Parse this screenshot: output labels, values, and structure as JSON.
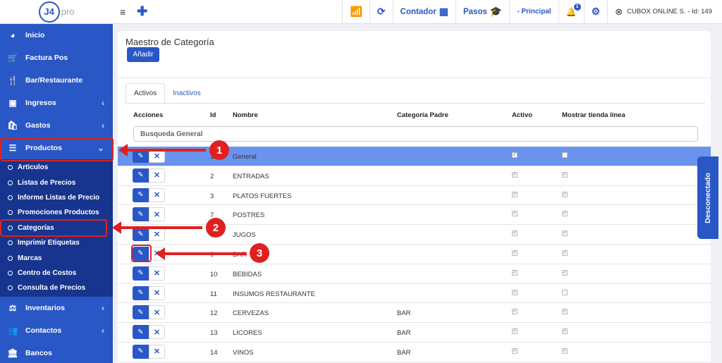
{
  "logo": {
    "mark": "J4",
    "suffix": "pro"
  },
  "topbar": {
    "contador": "Contador",
    "pasos": "Pasos",
    "principal": "- Principal",
    "notif_count": "1",
    "user": "CUBOX ONLINE S. - Id: 149"
  },
  "sidebar": {
    "items": [
      {
        "label": "Inicio",
        "icon": "palette-icon"
      },
      {
        "label": "Factura Pos",
        "icon": "cart-icon"
      },
      {
        "label": "Bar/Restaurante",
        "icon": "utensils-icon"
      },
      {
        "label": "Ingresos",
        "icon": "money-icon"
      },
      {
        "label": "Gastos",
        "icon": "bag-icon"
      },
      {
        "label": "Productos",
        "icon": "list-icon"
      }
    ],
    "submenu": [
      "Articulos",
      "Listas de Precios",
      "Informe Listas de Precio",
      "Promociones Productos",
      "Categorías",
      "Imprimir Etiquetas",
      "Marcas",
      "Centro de Costos",
      "Consulta de Precios"
    ],
    "items_after": [
      {
        "label": "Inventarios",
        "icon": "scale-icon"
      },
      {
        "label": "Contactos",
        "icon": "users-icon"
      },
      {
        "label": "Bancos",
        "icon": "bank-icon"
      }
    ]
  },
  "page": {
    "title": "Maestro de Categoría",
    "add_label": "Añadir",
    "tabs": [
      "Activos",
      "Inactivos"
    ],
    "search_placeholder": "Busqueda General"
  },
  "table": {
    "headers": [
      "Acciones",
      "Id",
      "Nombre",
      "Categoría Padre",
      "Activo",
      "Mostrar tienda línea"
    ],
    "rows": [
      {
        "id": "1",
        "name": "General",
        "parent": "",
        "active": true,
        "shop": false
      },
      {
        "id": "2",
        "name": "ENTRADAS",
        "parent": "",
        "active": true,
        "shop": true
      },
      {
        "id": "3",
        "name": "PLATOS FUERTES",
        "parent": "",
        "active": true,
        "shop": true
      },
      {
        "id": "7",
        "name": "POSTRES",
        "parent": "",
        "active": true,
        "shop": true
      },
      {
        "id": "8",
        "name": "JUGOS",
        "parent": "",
        "active": true,
        "shop": true
      },
      {
        "id": "9",
        "name": "BAR",
        "parent": "",
        "active": true,
        "shop": true
      },
      {
        "id": "10",
        "name": "BEBIDAS",
        "parent": "",
        "active": true,
        "shop": true
      },
      {
        "id": "11",
        "name": "INSUMOS RESTAURANTE",
        "parent": "",
        "active": true,
        "shop": false
      },
      {
        "id": "12",
        "name": "CERVEZAS",
        "parent": "BAR",
        "active": true,
        "shop": true
      },
      {
        "id": "13",
        "name": "LICORES",
        "parent": "BAR",
        "active": true,
        "shop": true
      },
      {
        "id": "14",
        "name": "VINOS",
        "parent": "BAR",
        "active": true,
        "shop": true
      }
    ]
  },
  "side_tab": "Desconectado",
  "annotations": {
    "c1": "1",
    "c2": "2",
    "c3": "3"
  },
  "colors": {
    "primary": "#2a57c6",
    "highlight": "#6a93ee",
    "annotation": "#e02020"
  }
}
